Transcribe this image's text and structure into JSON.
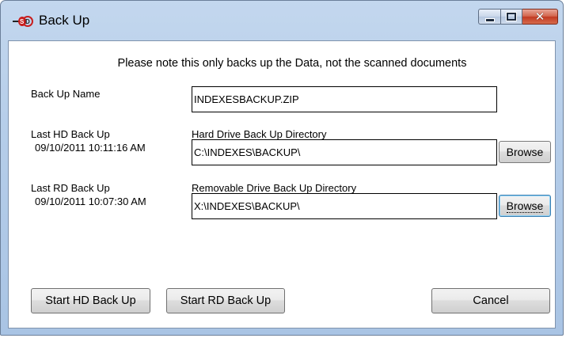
{
  "window": {
    "title": "Back Up",
    "app_icon": "sd-logo-icon",
    "controls": {
      "minimize": "minimize-icon",
      "maximize": "maximize-icon",
      "close": "close-icon"
    }
  },
  "note": "Please note this only backs up the Data, not the scanned documents",
  "backup_name": {
    "label": "Back Up Name",
    "value": "INDEXESBACKUP.ZIP"
  },
  "hd": {
    "last_label": "Last HD Back Up",
    "last_timestamp": "09/10/2011 10:11:16 AM",
    "dir_label": "Hard Drive Back Up Directory",
    "dir_value": "C:\\INDEXES\\BACKUP\\",
    "browse_label": "Browse"
  },
  "rd": {
    "last_label": "Last RD Back Up",
    "last_timestamp": "09/10/2011 10:07:30 AM",
    "dir_label": "Removable Drive Back Up Directory",
    "dir_value": "X:\\INDEXES\\BACKUP\\",
    "browse_label": "Browse"
  },
  "buttons": {
    "start_hd": "Start HD Back Up",
    "start_rd": "Start RD Back Up",
    "cancel": "Cancel"
  },
  "colors": {
    "titlebar": "#b5cde9",
    "close_button": "#c23a22",
    "focus_border": "#3c7fb1"
  }
}
